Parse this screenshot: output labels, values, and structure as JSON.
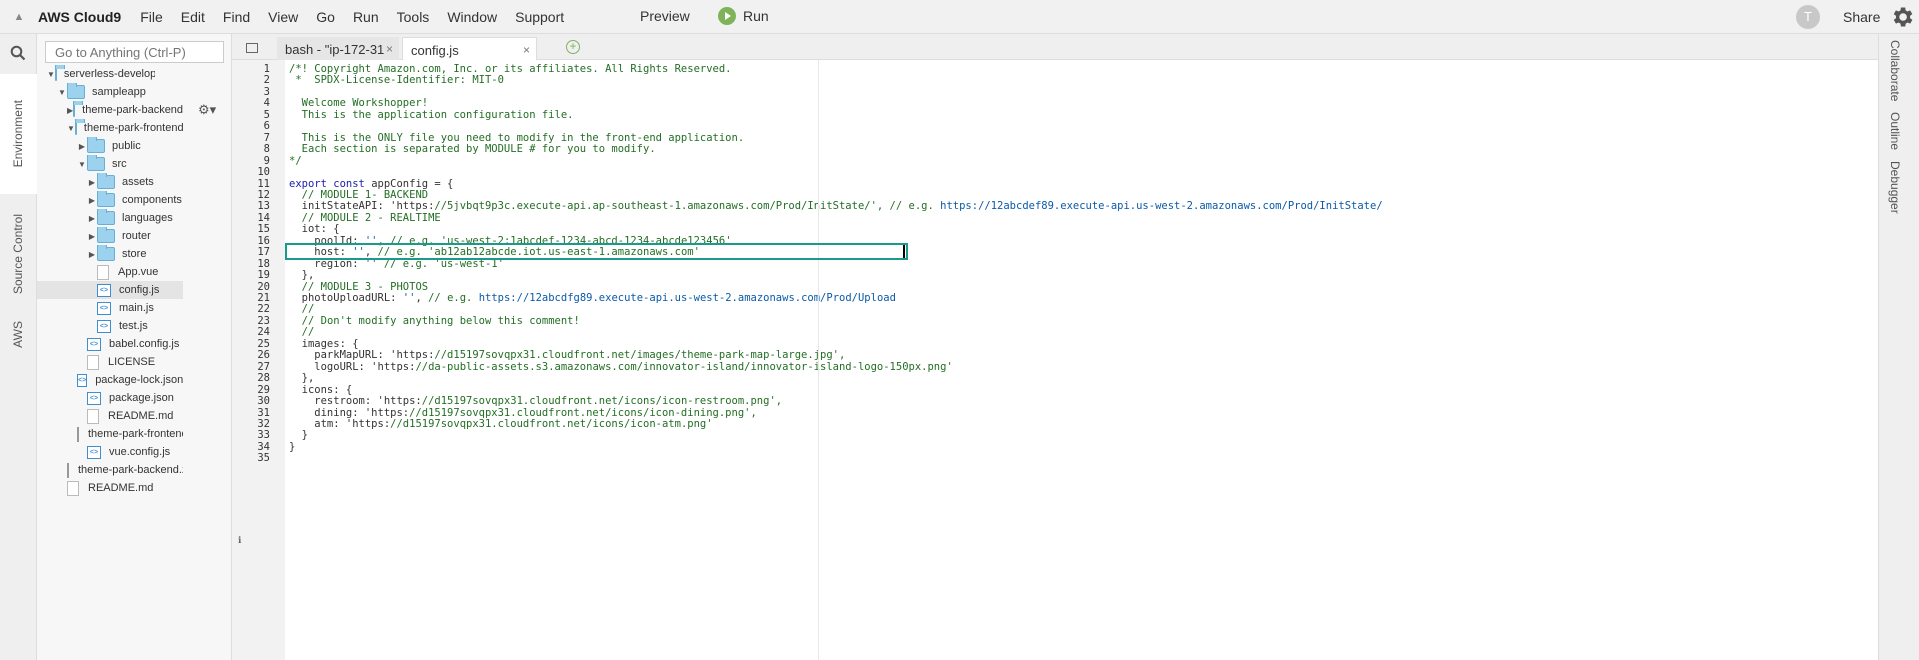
{
  "menubar": {
    "brand": "AWS Cloud9",
    "items": [
      "File",
      "Edit",
      "Find",
      "View",
      "Go",
      "Run",
      "Tools",
      "Window",
      "Support"
    ],
    "preview": "Preview",
    "run": "Run",
    "avatar_initial": "T",
    "share": "Share"
  },
  "left_rail": {
    "tabs": [
      "Environment",
      "Source Control",
      "AWS"
    ]
  },
  "tree": {
    "search_placeholder": "Go to Anything (Ctrl-P)",
    "rows": [
      {
        "label": "serverless-developn",
        "type": "folder",
        "expanded": true
      },
      {
        "label": "sampleapp",
        "type": "folder",
        "expanded": true
      },
      {
        "label": "theme-park-backend",
        "type": "folder",
        "expanded": false
      },
      {
        "label": "theme-park-frontend",
        "type": "folder",
        "expanded": true
      },
      {
        "label": "public",
        "type": "folder",
        "expanded": false
      },
      {
        "label": "src",
        "type": "folder",
        "expanded": true
      },
      {
        "label": "assets",
        "type": "folder",
        "expanded": false
      },
      {
        "label": "components",
        "type": "folder",
        "expanded": false
      },
      {
        "label": "languages",
        "type": "folder",
        "expanded": false
      },
      {
        "label": "router",
        "type": "folder",
        "expanded": false
      },
      {
        "label": "store",
        "type": "folder",
        "expanded": false
      },
      {
        "label": "App.vue",
        "type": "file"
      },
      {
        "label": "config.js",
        "type": "code",
        "selected": true
      },
      {
        "label": "main.js",
        "type": "code"
      },
      {
        "label": "test.js",
        "type": "code"
      },
      {
        "label": "babel.config.js",
        "type": "code"
      },
      {
        "label": "LICENSE",
        "type": "file"
      },
      {
        "label": "package-lock.json",
        "type": "code"
      },
      {
        "label": "package.json",
        "type": "code"
      },
      {
        "label": "README.md",
        "type": "file"
      },
      {
        "label": "theme-park-frontenc",
        "type": "zip"
      },
      {
        "label": "vue.config.js",
        "type": "code"
      },
      {
        "label": "theme-park-backend.z",
        "type": "zip"
      },
      {
        "label": "README.md",
        "type": "file"
      }
    ]
  },
  "tabs": {
    "bash": "bash - \"ip-172-31",
    "config": "config.js",
    "close": "×",
    "add": "+"
  },
  "editor": {
    "lines": [
      "/*! Copyright Amazon.com, Inc. or its affiliates. All Rights Reserved.",
      " *  SPDX-License-Identifier: MIT-0",
      "",
      "  Welcome Workshopper!",
      "  This is the application configuration file.",
      "",
      "  This is the ONLY file you need to modify in the front-end application.",
      "  Each section is separated by MODULE # for you to modify.",
      "*/",
      "",
      "export const appConfig = {",
      "  // MODULE 1- BACKEND",
      "  initStateAPI: 'https://5jvbqt9p3c.execute-api.ap-southeast-1.amazonaws.com/Prod/InitState/', // e.g. https://12abcdef89.execute-api.us-west-2.amazonaws.com/Prod/InitState/",
      "  // MODULE 2 - REALTIME",
      "  iot: {",
      "    poolId: '', // e.g. 'us-west-2:1abcdef-1234-abcd-1234-abcde123456'",
      "    host: '', // e.g. 'ab12ab12abcde.iot.us-east-1.amazonaws.com'",
      "    region: '' // e.g. 'us-west-1'",
      "  },",
      "  // MODULE 3 - PHOTOS",
      "  photoUploadURL: '', // e.g. https://12abcdfg89.execute-api.us-west-2.amazonaws.com/Prod/Upload",
      "  //",
      "  // Don't modify anything below this comment!",
      "  //",
      "  images: {",
      "    parkMapURL: 'https://d15197sovqpx31.cloudfront.net/images/theme-park-map-large.jpg',",
      "    logoURL: 'https://da-public-assets.s3.amazonaws.com/innovator-island/innovator-island-logo-150px.png'",
      "  },",
      "  icons: {",
      "    restroom: 'https://d15197sovqpx31.cloudfront.net/icons/icon-restroom.png',",
      "    dining: 'https://d15197sovqpx31.cloudfront.net/icons/icon-dining.png',",
      "    atm: 'https://d15197sovqpx31.cloudfront.net/icons/icon-atm.png'",
      "  }",
      "}",
      ""
    ]
  },
  "right_rail": {
    "tabs": [
      "Collaborate",
      "Outline",
      "Debugger"
    ]
  },
  "colors": {
    "highlight_box": "#1a9a8a",
    "run_green": "#7fb35b",
    "folder_blue": "#9dd2ef"
  }
}
